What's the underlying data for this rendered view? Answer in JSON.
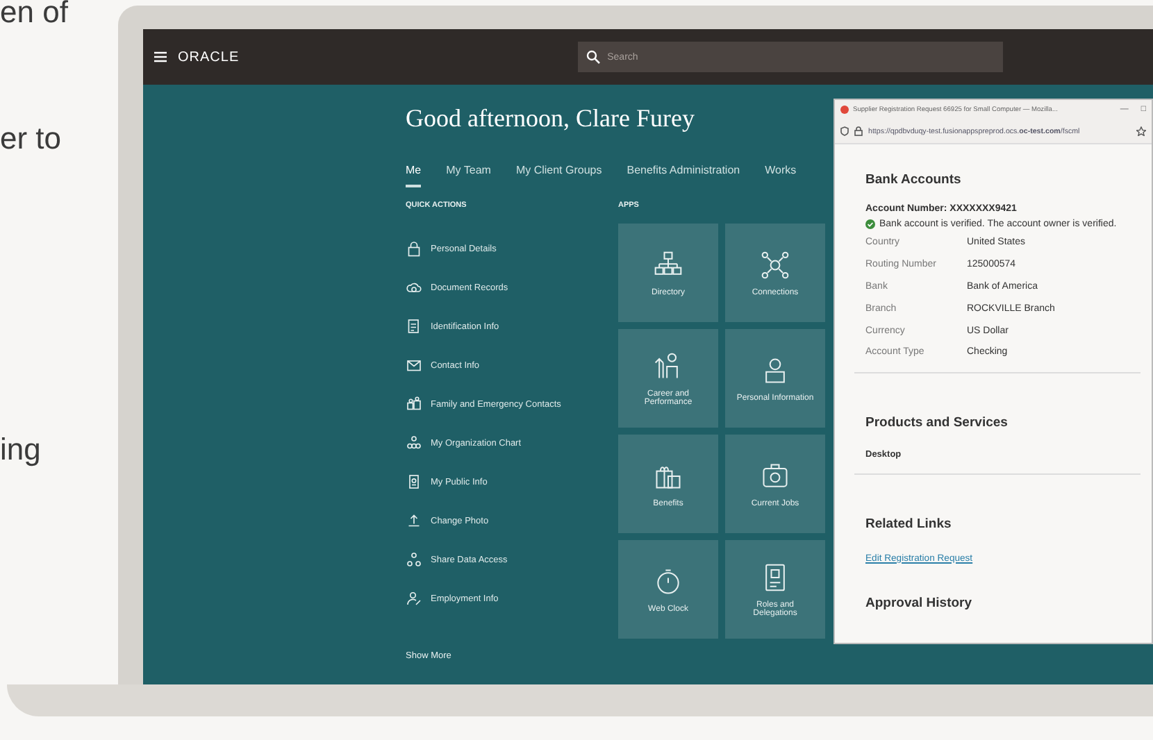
{
  "side_text": [
    "en of",
    "er to",
    "ing"
  ],
  "top_bar": {
    "logo": "ORACLE",
    "search": {
      "placeholder": "Search"
    }
  },
  "greeting": "Good afternoon, Clare Furey",
  "tabs": [
    {
      "label": "Me",
      "selected": true
    },
    {
      "label": "My Team",
      "selected": false
    },
    {
      "label": "My Client Groups",
      "selected": false
    },
    {
      "label": "Benefits Administration",
      "selected": false
    },
    {
      "label": "Works",
      "selected": false
    }
  ],
  "quick_actions": {
    "title": "QUICK ACTIONS",
    "items": [
      "Personal Details",
      "Document Records",
      "Identification Info",
      "Contact Info",
      "Family and Emergency Contacts",
      "My Organization Chart",
      "My Public Info",
      "Change Photo",
      "Share Data Access",
      "Employment Info"
    ],
    "show_more": "Show More"
  },
  "apps": {
    "title": "APPS",
    "tiles": [
      "Directory",
      "Connections",
      "Career and Performance",
      "Personal Information",
      "Benefits",
      "Current Jobs",
      "Web Clock",
      "Roles and Delegations"
    ]
  },
  "popup": {
    "title": "Supplier Registration Request 66925 for Small Computer — Mozilla...",
    "minimize": "—",
    "maximize": "□",
    "url": "https://qpdbvduqy-test.fusionappspreprod.ocs.**oc-test.com**/fscml",
    "bank_heading": "Bank Accounts",
    "account_number": "Account Number: XXXXXXX9421",
    "verified": "Bank account is verified. The account owner is verified.",
    "fields": [
      {
        "label": "Country",
        "value": "United States"
      },
      {
        "label": "Routing Number",
        "value": "125000574"
      },
      {
        "label": "Bank",
        "value": "Bank of America"
      },
      {
        "label": "Branch",
        "value": "ROCKVILLE Branch"
      },
      {
        "label": "Currency",
        "value": "US Dollar"
      },
      {
        "label": "Account Type",
        "value": "Checking"
      }
    ],
    "products_heading": "Products and Services",
    "product": "Desktop",
    "links_heading": "Related Links",
    "link": "Edit Registration Request",
    "approval_heading": "Approval History"
  }
}
